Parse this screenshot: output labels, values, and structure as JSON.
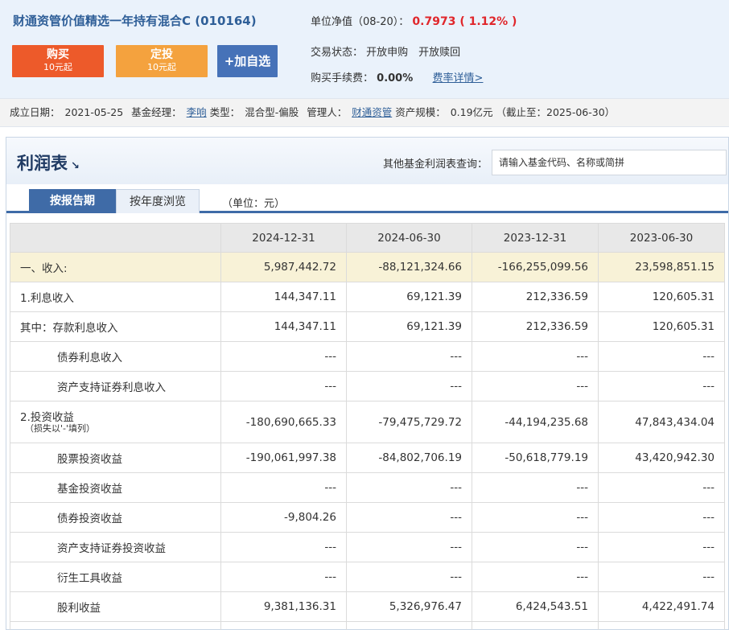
{
  "fund": {
    "title": "财通资管价值精选一年持有混合C (010164)",
    "nav_label": "单位净值（08-20）：",
    "nav_value": "0.7973 ( 1.12% )",
    "trade_status_label": "交易状态：",
    "trade_status_value": "开放申购　开放赎回",
    "fee_label": "购买手续费：",
    "fee_value": "0.00%",
    "fee_link": "费率详情>"
  },
  "buttons": {
    "buy_line1": "购买",
    "buy_line2": "10元起",
    "plan_line1": "定投",
    "plan_line2": "10元起",
    "fav": "+加自选"
  },
  "meta": {
    "established_label": "成立日期：",
    "established_value": "2021-05-25",
    "manager_label": "基金经理：",
    "manager_value": "李响",
    "type_label": "类型：",
    "type_value": "混合型-偏股",
    "admin_label": "管理人：",
    "admin_value": "财通资管",
    "scale_label": "资产规模：",
    "scale_value": "0.19亿元 （截止至：2025-06-30）"
  },
  "panel": {
    "title": "利润表",
    "title_arrow": "↘",
    "query_label": "其他基金利润表查询：",
    "query_placeholder": "请输入基金代码、名称或简拼",
    "tab_report": "按报告期",
    "tab_year": "按年度浏览",
    "unit": "（单位：元）"
  },
  "table": {
    "headers": [
      "",
      "2024-12-31",
      "2024-06-30",
      "2023-12-31",
      "2023-06-30"
    ],
    "rows": [
      {
        "label": "一、收入:",
        "values": [
          "5,987,442.72",
          "-88,121,324.66",
          "-166,255,099.56",
          "23,598,851.15"
        ]
      },
      {
        "label": "1.利息收入",
        "values": [
          "144,347.11",
          "69,121.39",
          "212,336.59",
          "120,605.31"
        ]
      },
      {
        "label": "其中：存款利息收入",
        "values": [
          "144,347.11",
          "69,121.39",
          "212,336.59",
          "120,605.31"
        ]
      },
      {
        "label": "债券利息收入",
        "values": [
          "---",
          "---",
          "---",
          "---"
        ]
      },
      {
        "label": "资产支持证券利息收入",
        "values": [
          "---",
          "---",
          "---",
          "---"
        ]
      },
      {
        "label": "2.投资收益",
        "sub": "（损失以'-'填列）",
        "values": [
          "-180,690,665.33",
          "-79,475,729.72",
          "-44,194,235.68",
          "47,843,434.04"
        ]
      },
      {
        "label": "股票投资收益",
        "values": [
          "-190,061,997.38",
          "-84,802,706.19",
          "-50,618,779.19",
          "43,420,942.30"
        ]
      },
      {
        "label": "基金投资收益",
        "values": [
          "---",
          "---",
          "---",
          "---"
        ]
      },
      {
        "label": "债券投资收益",
        "values": [
          "-9,804.26",
          "---",
          "---",
          "---"
        ]
      },
      {
        "label": "资产支持证券投资收益",
        "values": [
          "---",
          "---",
          "---",
          "---"
        ]
      },
      {
        "label": "衍生工具收益",
        "values": [
          "---",
          "---",
          "---",
          "---"
        ]
      },
      {
        "label": "股利收益",
        "values": [
          "9,381,136.31",
          "5,326,976.47",
          "6,424,543.51",
          "4,422,491.74"
        ]
      }
    ]
  },
  "colors": {
    "buy": "#ed5a2a",
    "plan": "#f4a23e",
    "fav": "#4672b8",
    "nav_red": "#e0262b",
    "link_blue": "#2f5f98",
    "tab_active": "#3f6ba7",
    "highlight_row": "#f8f2d7"
  }
}
